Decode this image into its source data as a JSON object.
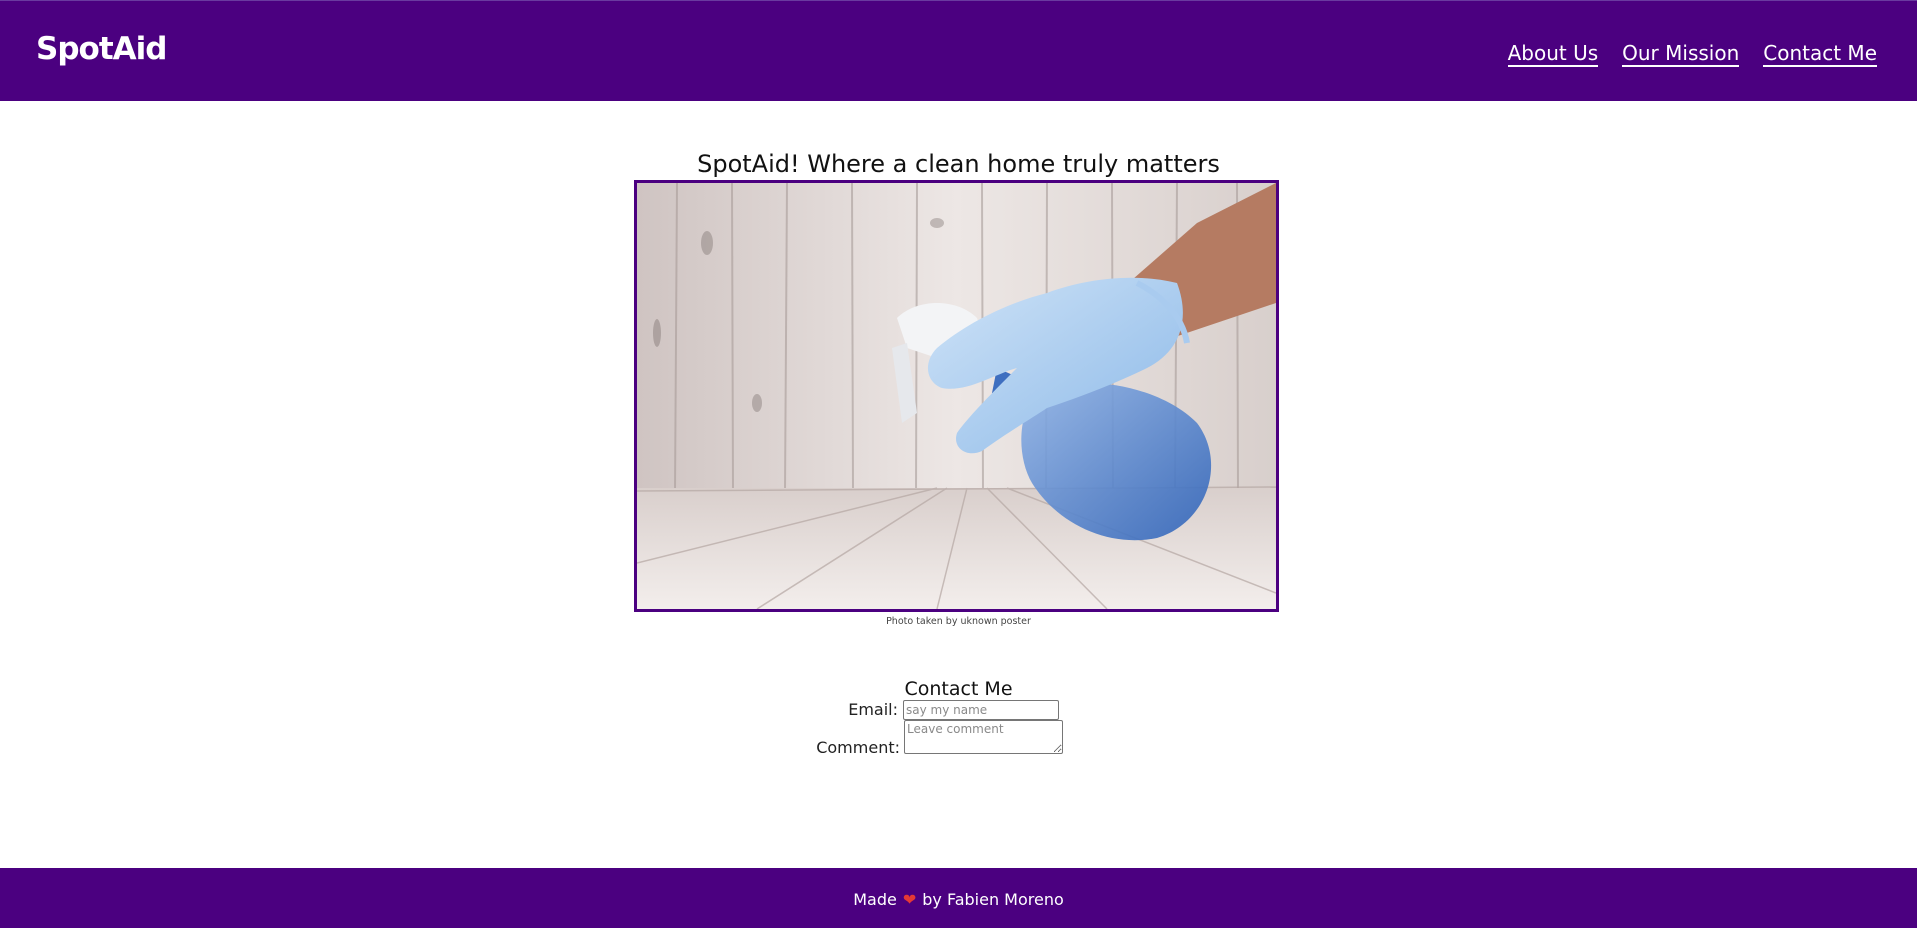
{
  "header": {
    "logo": "SpotAid",
    "nav": [
      {
        "label": "About Us"
      },
      {
        "label": "Our Mission"
      },
      {
        "label": "Contact Me"
      }
    ]
  },
  "main": {
    "title": "SpotAid! Where a clean home truly matters",
    "photo_caption": "Photo taken by uknown poster"
  },
  "contact": {
    "title": "Contact Me",
    "email_label": "Email:",
    "email_placeholder": "say my name",
    "comment_label": "Comment:",
    "comment_placeholder": "Leave comment"
  },
  "footer": {
    "made": "Made",
    "heart_icon": "heart-icon",
    "by": "by Fabien Moreno"
  },
  "colors": {
    "brand": "#4b0080",
    "heart": "#e53935"
  }
}
